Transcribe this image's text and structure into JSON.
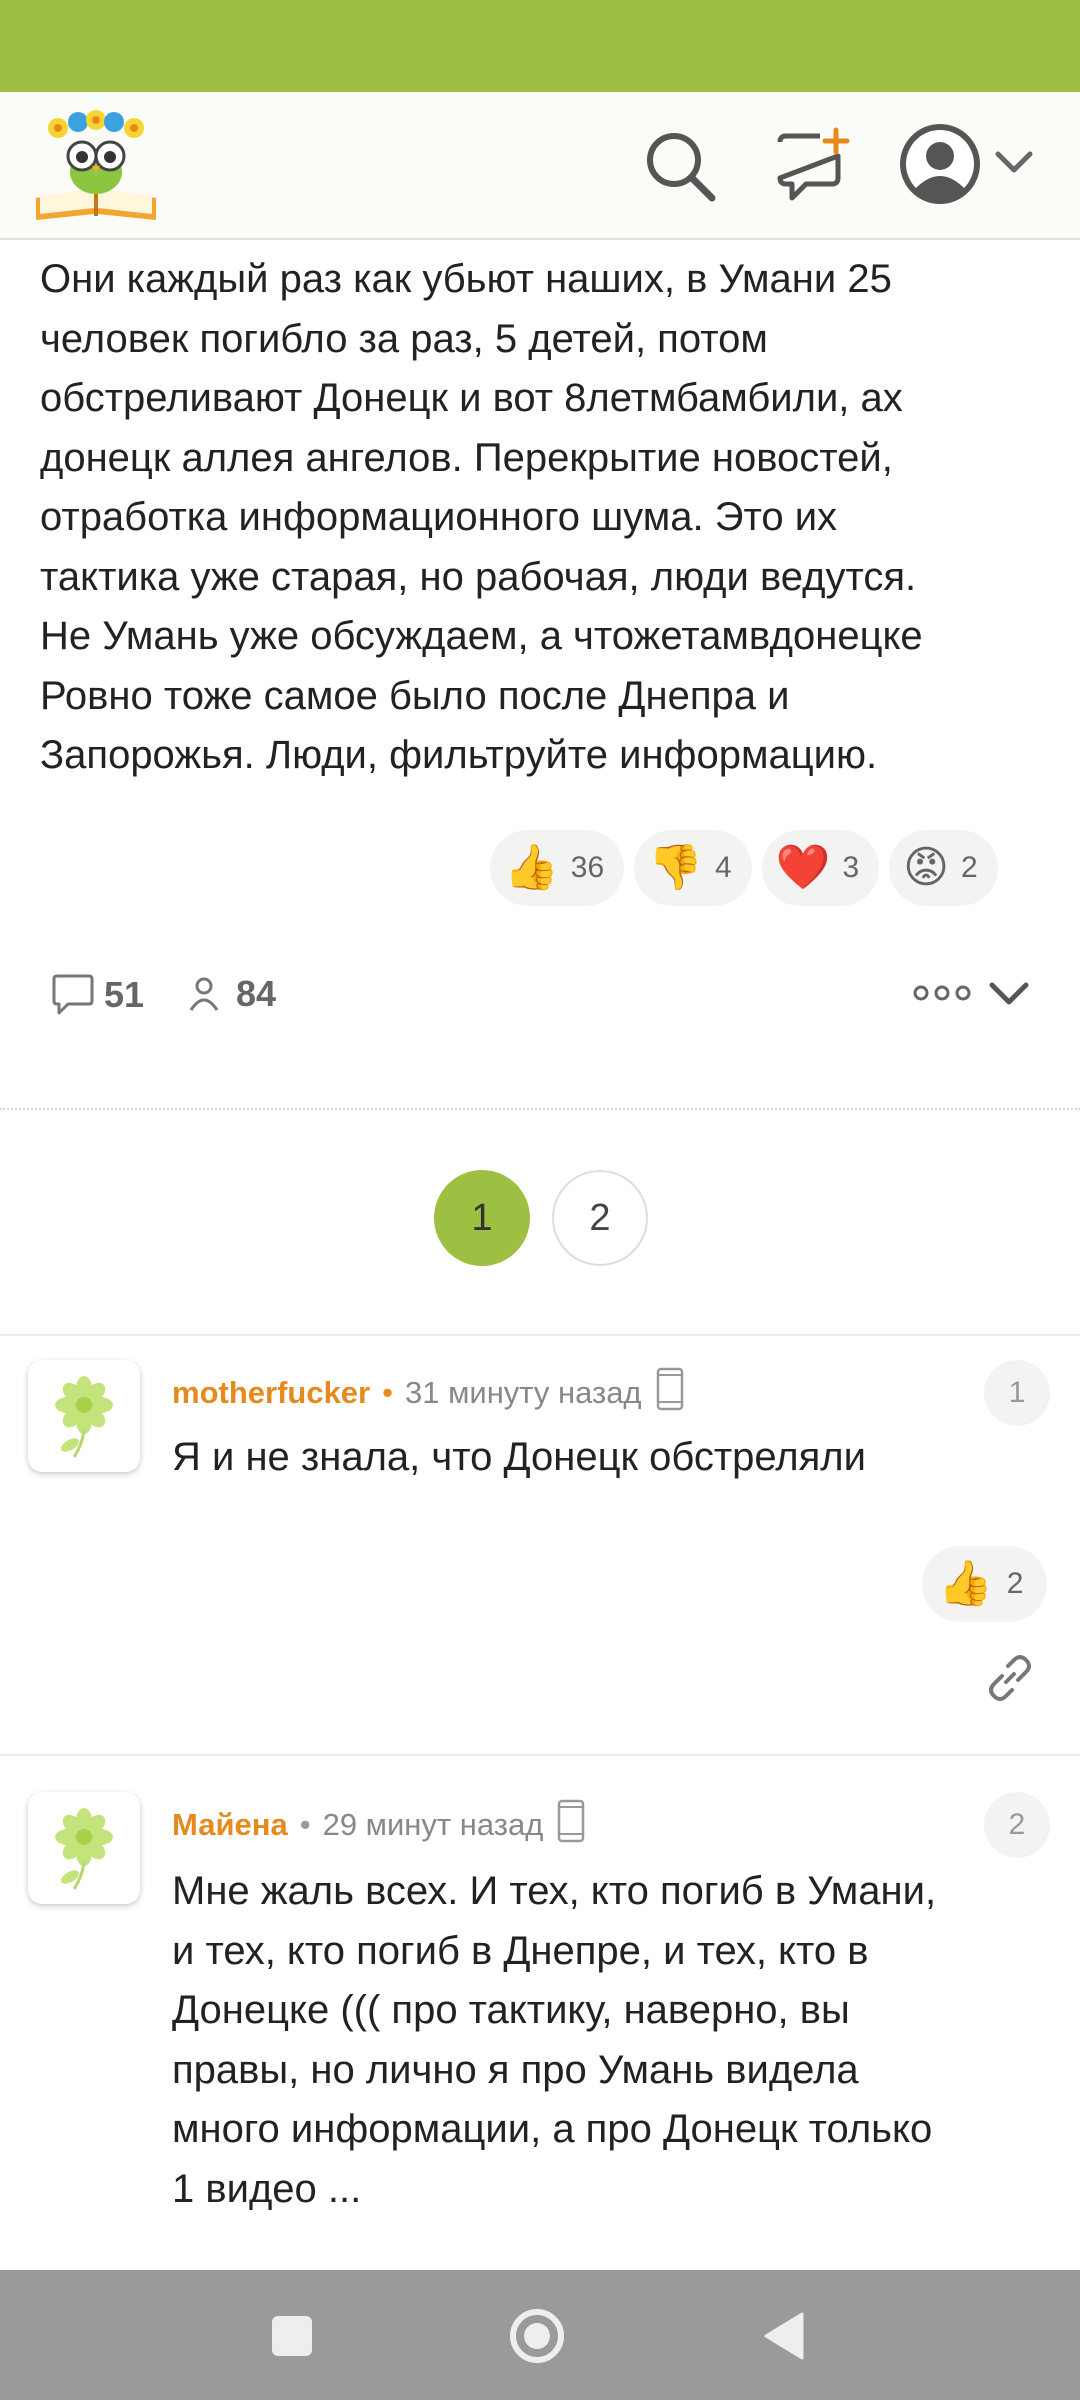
{
  "post": {
    "lines": [
      "Они каждый раз как убьют наших, в Умани 25",
      "человек погибло за раз, 5 детей, потом",
      "обстреливают Донецк и вот 8летмбамбили, ах",
      "донецк аллея ангелов. Перекрытие новостей,",
      "отработка информационного шума. Это их",
      "тактика уже старая, но рабочая, люди ведутся.",
      "Не Умань уже обсуждаем, а чтожетамвдонецке",
      "Ровно тоже самое было после Днепра и",
      "Запорожья. Люди, фильтруйте информацию."
    ],
    "reactions": [
      {
        "emoji": "👍",
        "count": "36"
      },
      {
        "emoji": "👎",
        "count": "4"
      },
      {
        "emoji": "❤️",
        "count": "3"
      },
      {
        "emoji": "😡",
        "count": "2"
      }
    ],
    "comments_count": "51",
    "participants_count": "84"
  },
  "pagination": {
    "pages": [
      "1",
      "2"
    ],
    "current": "1"
  },
  "comments": [
    {
      "author": "motherfucker",
      "time": "31 минуту назад",
      "number": "1",
      "lines": [
        "Я и не знала, что Донецк обстреляли"
      ],
      "likes": {
        "emoji": "👍",
        "count": "2"
      }
    },
    {
      "author": "Майена",
      "time": "29 минут назад",
      "number": "2",
      "lines": [
        "Мне жаль всех. И тех, кто погиб в Умани,",
        "и тех, кто погиб в Днепре, и тех, кто в",
        "Донецке ((( про тактику, наверно, вы",
        "правы, но лично я про Умань видела",
        "много информации, а про Донецк только",
        "1 видео ..."
      ]
    }
  ],
  "colors": {
    "accent": "#9dc043",
    "author": "#e68a1e",
    "navbar": "#9a9a9a"
  }
}
